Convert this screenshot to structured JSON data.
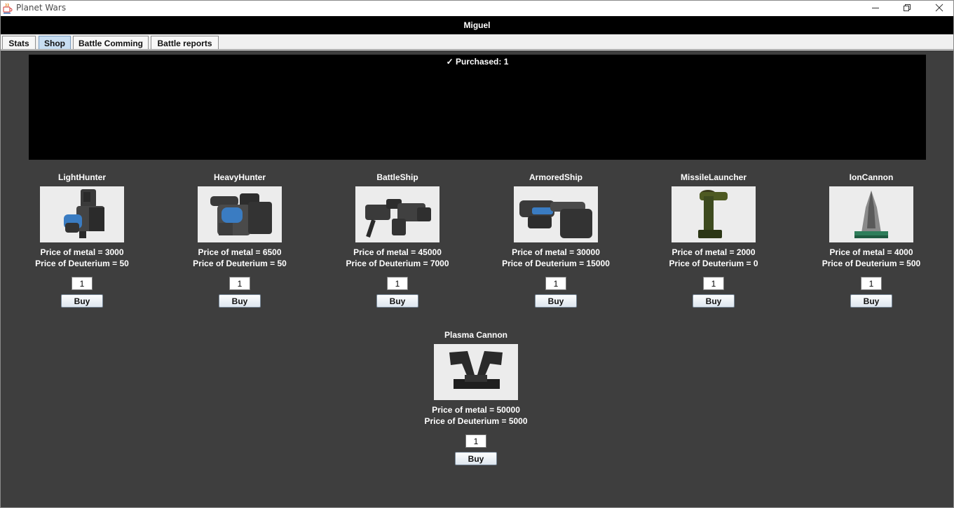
{
  "window": {
    "title": "Planet Wars"
  },
  "user": {
    "name": "Miguel"
  },
  "tabs": [
    {
      "label": "Stats"
    },
    {
      "label": "Shop",
      "active": true
    },
    {
      "label": "Battle Comming"
    },
    {
      "label": "Battle reports"
    }
  ],
  "message": "✓ Purchased: 1",
  "colors": {
    "panel": "#3e3e3e",
    "message_box": "#000000",
    "active_tab": "#c8def2"
  },
  "items": [
    {
      "name": "LightHunter",
      "icon": "light-hunter-image",
      "metal": "Price of metal = 3000",
      "deuterium": "Price of Deuterium = 50",
      "qty": "1",
      "buy": "Buy"
    },
    {
      "name": "HeavyHunter",
      "icon": "heavy-hunter-image",
      "metal": "Price of metal = 6500",
      "deuterium": "Price of Deuterium = 50",
      "qty": "1",
      "buy": "Buy"
    },
    {
      "name": "BattleShip",
      "icon": "battleship-image",
      "metal": "Price of metal = 45000",
      "deuterium": "Price of Deuterium = 7000",
      "qty": "1",
      "buy": "Buy"
    },
    {
      "name": "ArmoredShip",
      "icon": "armored-ship-image",
      "metal": "Price of metal = 30000",
      "deuterium": "Price of Deuterium = 15000",
      "qty": "1",
      "buy": "Buy"
    },
    {
      "name": "MissileLauncher",
      "icon": "missile-launcher-image",
      "metal": "Price of metal = 2000",
      "deuterium": "Price of Deuterium = 0",
      "qty": "1",
      "buy": "Buy"
    },
    {
      "name": "IonCannon",
      "icon": "ion-cannon-image",
      "metal": "Price of metal = 4000",
      "deuterium": "Price of Deuterium = 500",
      "qty": "1",
      "buy": "Buy"
    },
    {
      "name": "Plasma Cannon",
      "icon": "plasma-cannon-image",
      "metal": "Price of metal = 50000",
      "deuterium": "Price of Deuterium = 5000",
      "qty": "1",
      "buy": "Buy"
    }
  ]
}
